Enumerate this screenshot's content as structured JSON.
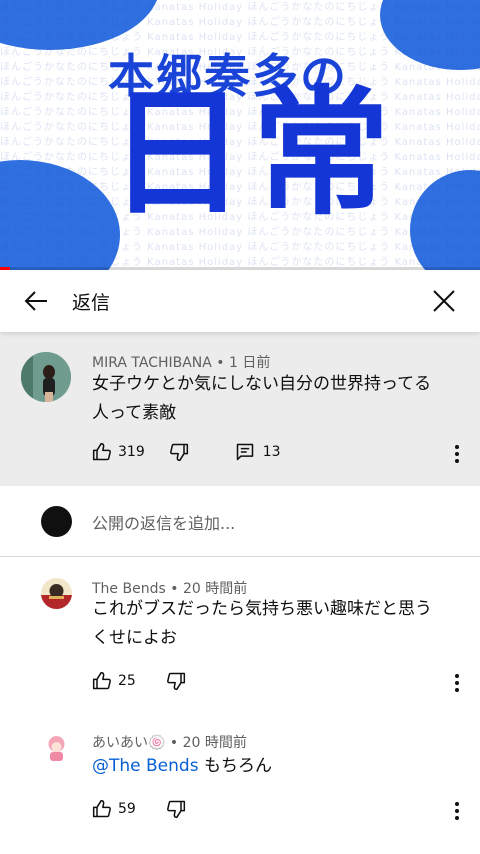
{
  "video": {
    "subtitle": "本郷奏多の",
    "title": "日常",
    "pattern_text": "ほんごうかなたのにちじょう Kanatas Holiday ほんごうかなたのにちじょう Kanatas Holiday ほんごうかなたのにちじょう Kanatas Holiday",
    "progress": 0.02,
    "colors": {
      "brand_blue": "#1436d6",
      "blob": "#2f6fe0",
      "progress": "#ff0000"
    }
  },
  "header": {
    "title": "返信",
    "back_icon": "arrow-left-icon",
    "close_icon": "close-icon"
  },
  "parent_comment": {
    "author": "MIRA TACHIBANA",
    "time": "1 日前",
    "meta_sep": " • ",
    "lines": [
      "女子ウケとか気にしない自分の世界持ってる",
      "人って素敵"
    ],
    "likes": "319",
    "replies": "13"
  },
  "add_reply": {
    "placeholder": "公開の返信を追加..."
  },
  "replies": [
    {
      "author": "The Bends",
      "time": "20 時間前",
      "lines": [
        "これがブスだったら気持ち悪い趣味だと思う",
        "くせによお"
      ],
      "likes": "25"
    },
    {
      "author": "あいあい🍥",
      "time": "20 時間前",
      "mention": "@The Bends",
      "text": " もちろん",
      "likes": "59"
    }
  ]
}
